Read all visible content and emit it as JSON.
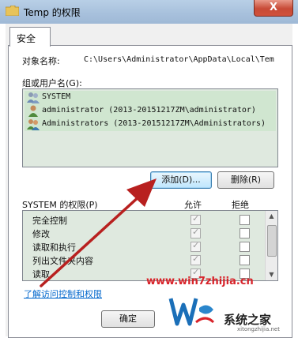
{
  "window": {
    "title": "Temp 的权限",
    "close_label": "X"
  },
  "tabs": [
    {
      "label": "安全"
    }
  ],
  "object": {
    "label": "对象名称:",
    "path": "C:\\Users\\Administrator\\AppData\\Local\\Tem"
  },
  "groups": {
    "label": "组或用户名(G):",
    "items": [
      {
        "name": "SYSTEM"
      },
      {
        "name": "administrator (2013-20151217ZM\\administrator)"
      },
      {
        "name": "Administrators (2013-20151217ZM\\Administrators)"
      }
    ],
    "add_label": "添加(D)...",
    "remove_label": "删除(R)"
  },
  "permissions": {
    "label": "SYSTEM 的权限(P)",
    "allow_header": "允许",
    "deny_header": "拒绝",
    "rows": [
      {
        "name": "完全控制",
        "allow": true,
        "deny": false
      },
      {
        "name": "修改",
        "allow": true,
        "deny": false
      },
      {
        "name": "读取和执行",
        "allow": true,
        "deny": false
      },
      {
        "name": "列出文件夹内容",
        "allow": true,
        "deny": false
      },
      {
        "name": "读取",
        "allow": true,
        "deny": false
      }
    ]
  },
  "learn_link": "了解访问控制和权限",
  "buttons": {
    "ok_label": "确定"
  },
  "watermark": {
    "url": "www.win7zhijia.cn",
    "site": "系统之家",
    "small": "xitongzhijia.net"
  },
  "colors": {
    "list_bg": "#dfe9df",
    "link": "#0066cc",
    "watermark_red": "#d8232a",
    "arrow_red": "#b8201f"
  }
}
